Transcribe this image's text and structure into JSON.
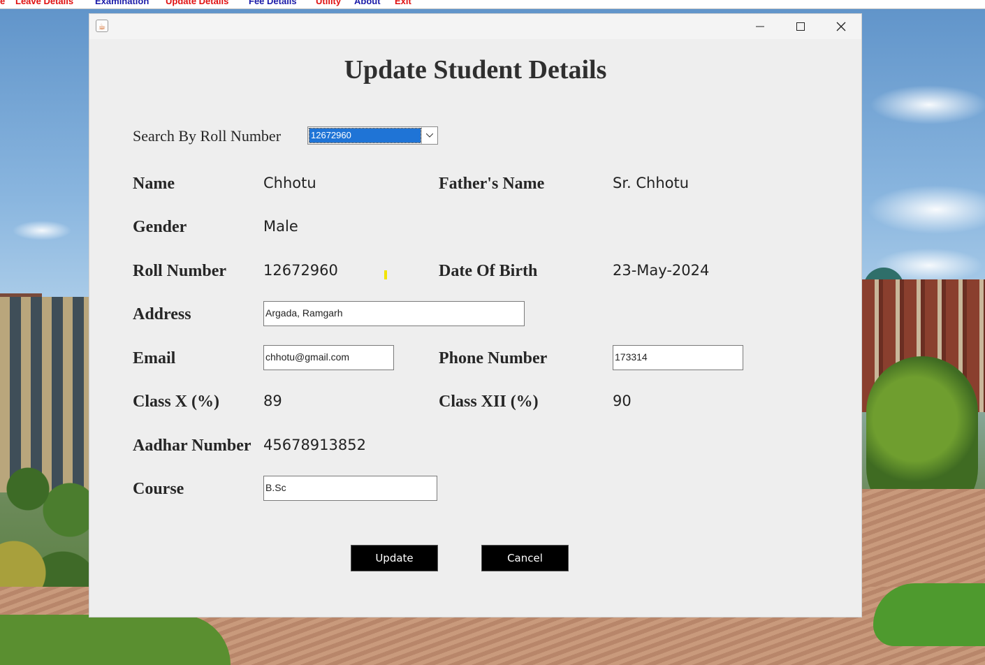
{
  "menubar": {
    "items": [
      {
        "label": "e",
        "color": "#e01010"
      },
      {
        "label": "Leave Details",
        "color": "#e01010"
      },
      {
        "label": "Examination",
        "color": "#1a1aa8"
      },
      {
        "label": "Update Details",
        "color": "#e01010"
      },
      {
        "label": "Fee Details",
        "color": "#1a1aa8"
      },
      {
        "label": "Utility",
        "color": "#e01010"
      },
      {
        "label": "About",
        "color": "#1a1aa8"
      },
      {
        "label": "Exit",
        "color": "#e01010"
      }
    ]
  },
  "window": {
    "icon": "java-icon",
    "controls": [
      "minimize-icon",
      "maximize-icon",
      "close-icon"
    ]
  },
  "form": {
    "title": "Update Student Details",
    "search_label": "Search By Roll Number",
    "search_selected": "12672960",
    "fields": {
      "name_label": "Name",
      "name_value": "Chhotu",
      "father_label": "Father's Name",
      "father_value": "Sr. Chhotu",
      "gender_label": "Gender",
      "gender_value": "Male",
      "roll_label": "Roll Number",
      "roll_value": "12672960",
      "dob_label": "Date Of Birth",
      "dob_value": "23-May-2024",
      "address_label": "Address",
      "address_value": "Argada, Ramgarh",
      "email_label": "Email",
      "email_value": "chhotu@gmail.com",
      "phone_label": "Phone Number",
      "phone_value": "173314",
      "classx_label": "Class X (%)",
      "classx_value": "89",
      "classxii_label": "Class XII (%)",
      "classxii_value": "90",
      "aadhar_label": "Aadhar Number",
      "aadhar_value": "45678913852",
      "course_label": "Course",
      "course_value": "B.Sc"
    },
    "buttons": {
      "update": "Update",
      "cancel": "Cancel"
    }
  }
}
